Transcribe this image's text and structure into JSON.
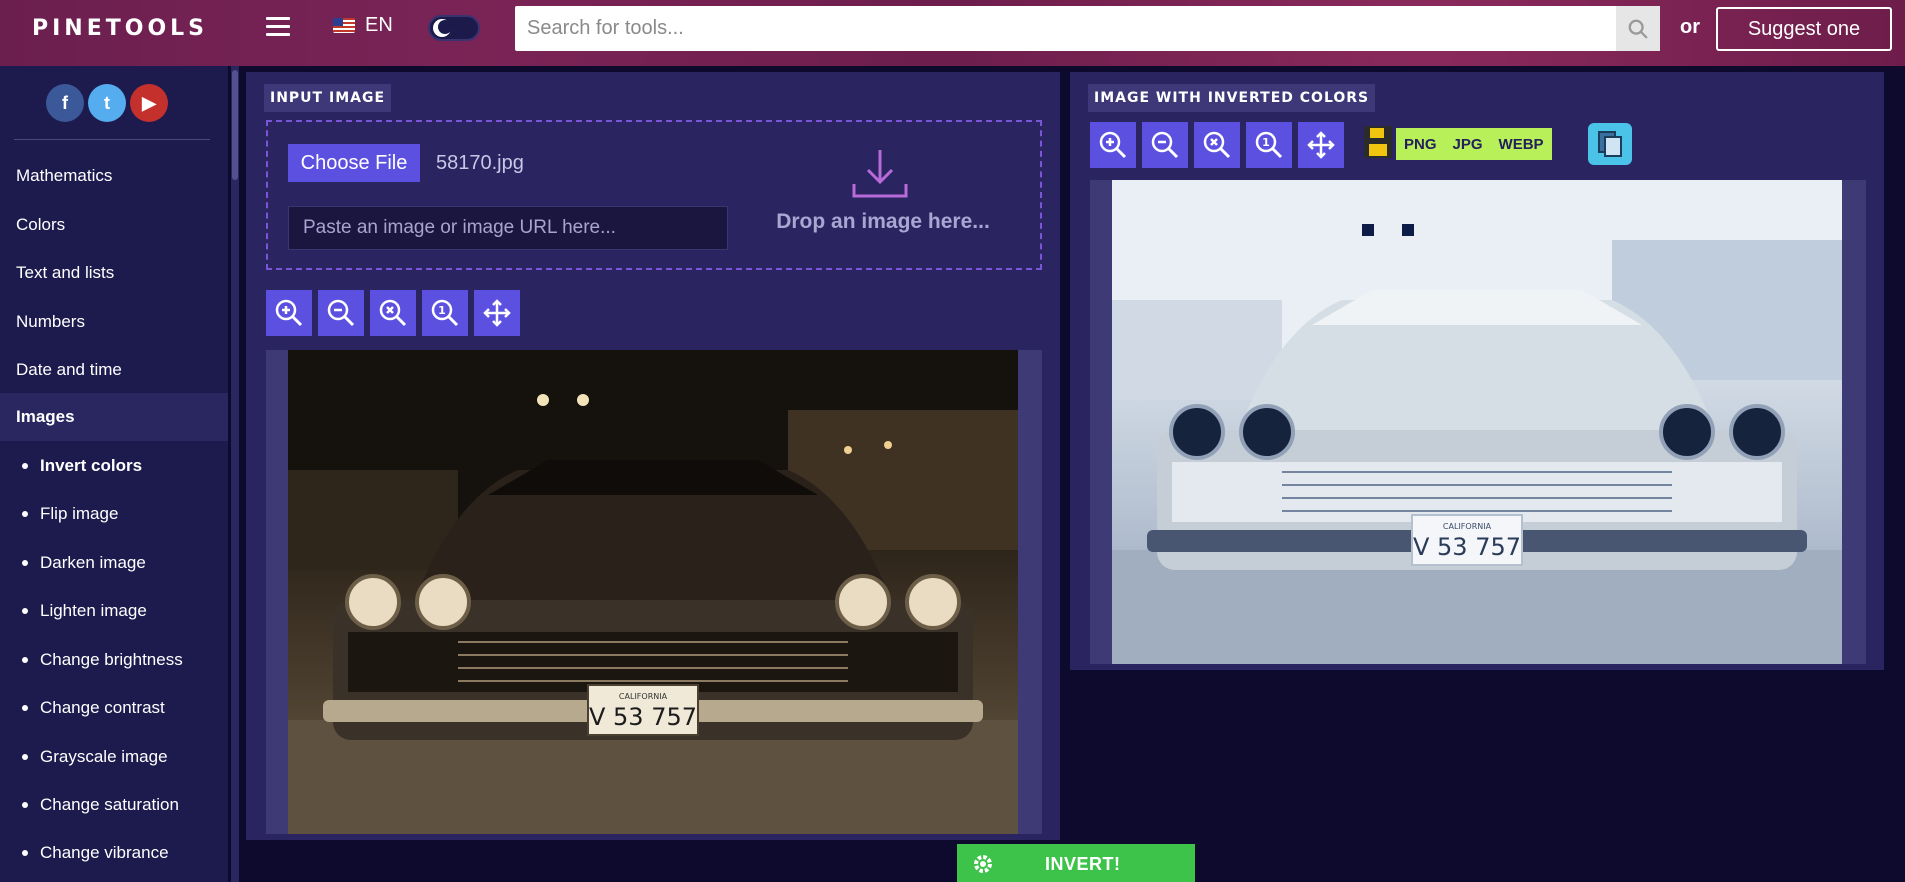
{
  "header": {
    "logo": "PINETOOLS",
    "language": "EN",
    "search_placeholder": "Search for tools...",
    "or_text": "or",
    "suggest_label": "Suggest one"
  },
  "sidebar": {
    "social": [
      "f",
      "t",
      "▶"
    ],
    "categories": [
      "Mathematics",
      "Colors",
      "Text and lists",
      "Numbers",
      "Date and time",
      "Images"
    ],
    "active_category": "Images",
    "subitems": [
      "Invert colors",
      "Flip image",
      "Darken image",
      "Lighten image",
      "Change brightness",
      "Change contrast",
      "Grayscale image",
      "Change saturation",
      "Change vibrance"
    ],
    "active_subitem": "Invert colors"
  },
  "input_panel": {
    "title": "INPUT IMAGE",
    "choose_file_label": "Choose File",
    "file_name": "58170.jpg",
    "paste_placeholder": "Paste an image or image URL here...",
    "drop_text": "Drop an image here...",
    "plate_text": "V 53 757",
    "plate_state": "CALIFORNIA"
  },
  "output_panel": {
    "title": "IMAGE WITH INVERTED COLORS",
    "formats": [
      "PNG",
      "JPG",
      "WEBP"
    ],
    "plate_text": "V 53 757",
    "plate_state": "CALIFORNIA"
  },
  "action": {
    "invert_label": "INVERT!"
  },
  "colors": {
    "accent": "#5b50e0",
    "panel": "#2a2460",
    "format_bg": "#b8f05a",
    "invert_bg": "#3ec34a",
    "header": "#6b1f4f"
  }
}
